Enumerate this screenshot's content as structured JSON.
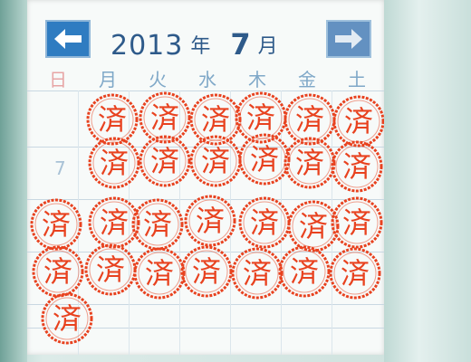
{
  "calendar": {
    "year": "2013",
    "year_unit": "年",
    "month": "7",
    "month_unit": "月",
    "prev_icon": "left-arrow-icon",
    "next_icon": "right-arrow-icon"
  },
  "weekdays": [
    "日",
    "月",
    "火",
    "水",
    "木",
    "金",
    "土"
  ],
  "visible_day_numbers": [
    "7"
  ],
  "stamp": {
    "text": "済",
    "color": "#e8421f",
    "count": 27
  }
}
